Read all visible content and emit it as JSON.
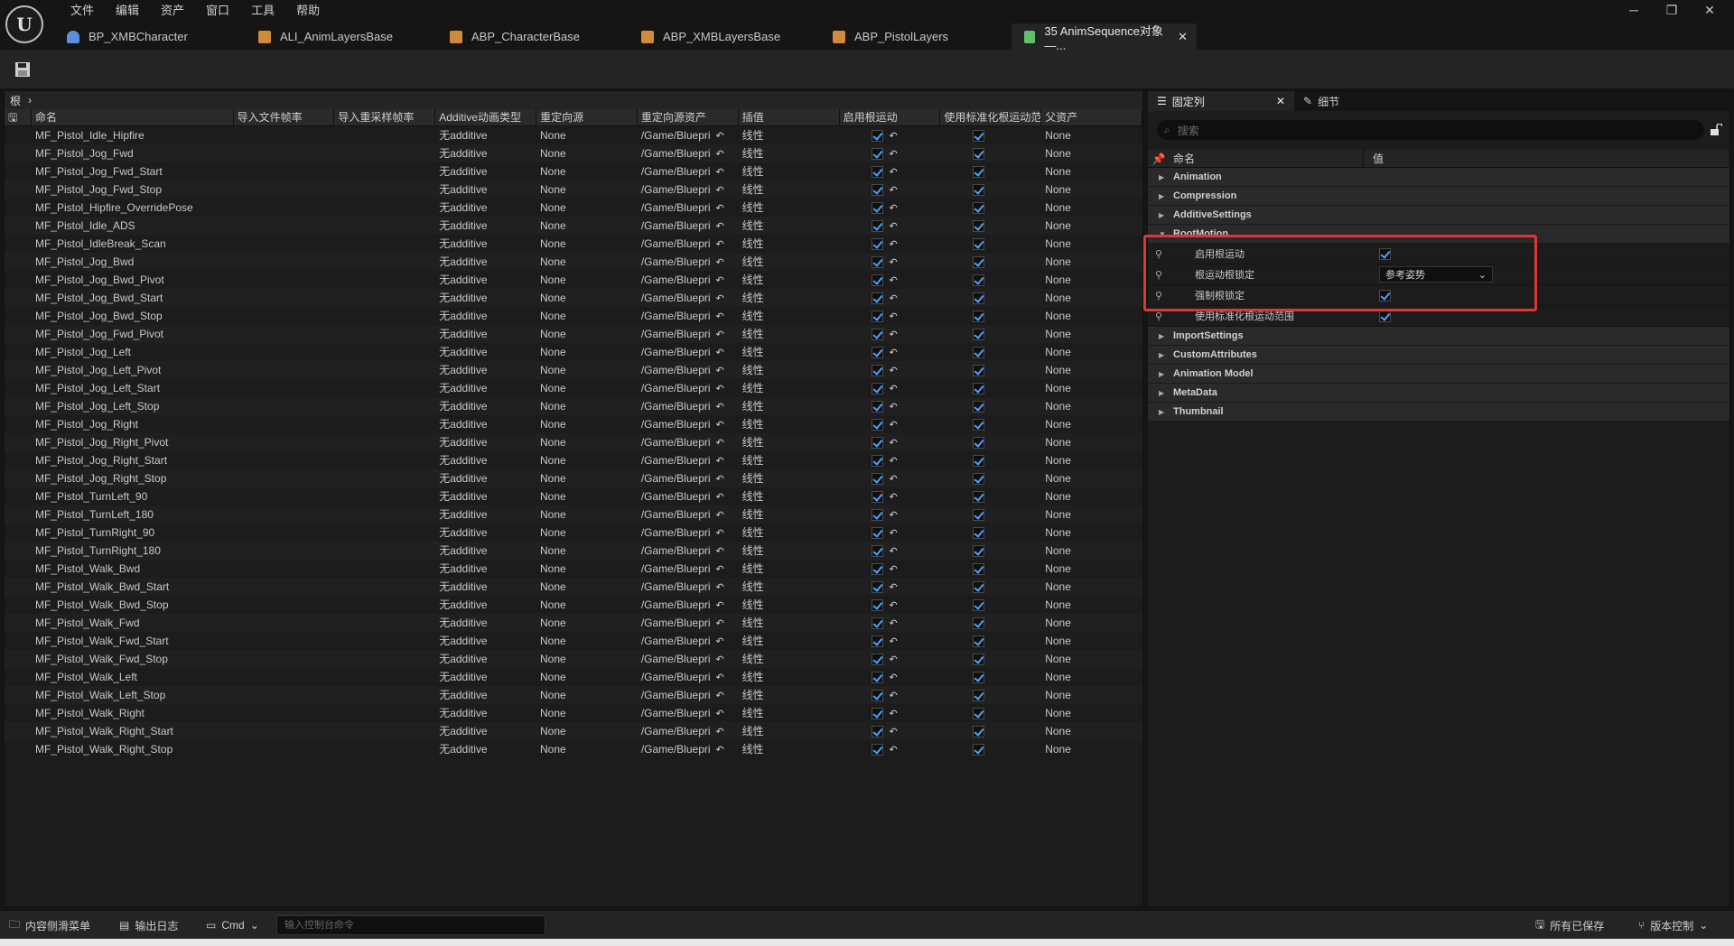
{
  "menu": [
    "文件",
    "编辑",
    "资产",
    "窗口",
    "工具",
    "帮助"
  ],
  "tabs": [
    {
      "label": "BP_XMBCharacter",
      "icon": "person-icon",
      "color": "#5b8fe0"
    },
    {
      "label": "ALI_AnimLayersBase",
      "icon": "anim-layer-icon",
      "color": "#d08b3a"
    },
    {
      "label": "ABP_CharacterBase",
      "icon": "anim-blueprint-icon",
      "color": "#d08b3a"
    },
    {
      "label": "ABP_XMBLayersBase",
      "icon": "anim-blueprint-icon",
      "color": "#d08b3a"
    },
    {
      "label": "ABP_PistolLayers",
      "icon": "anim-blueprint-icon",
      "color": "#d08b3a"
    },
    {
      "label": "35 AnimSequence对象—...",
      "icon": "anim-sequence-icon",
      "color": "#5fbf6a",
      "active": true
    }
  ],
  "breadcrumb": {
    "root": "根"
  },
  "grid": {
    "headers": [
      "命名",
      "导入文件帧率",
      "导入重采样帧率",
      "Additive动画类型",
      "重定向源",
      "重定向源资产",
      "插值",
      "启用根运动",
      "使用标准化根运动范",
      "父资产"
    ],
    "common": {
      "additive": "无additive",
      "retarget": "None",
      "asset": "/Game/Bluepri",
      "interp": "线性",
      "parent": "None"
    },
    "rows": [
      "MF_Pistol_Idle_Hipfire",
      "MF_Pistol_Jog_Fwd",
      "MF_Pistol_Jog_Fwd_Start",
      "MF_Pistol_Jog_Fwd_Stop",
      "MF_Pistol_Hipfire_OverridePose",
      "MF_Pistol_Idle_ADS",
      "MF_Pistol_IdleBreak_Scan",
      "MF_Pistol_Jog_Bwd",
      "MF_Pistol_Jog_Bwd_Pivot",
      "MF_Pistol_Jog_Bwd_Start",
      "MF_Pistol_Jog_Bwd_Stop",
      "MF_Pistol_Jog_Fwd_Pivot",
      "MF_Pistol_Jog_Left",
      "MF_Pistol_Jog_Left_Pivot",
      "MF_Pistol_Jog_Left_Start",
      "MF_Pistol_Jog_Left_Stop",
      "MF_Pistol_Jog_Right",
      "MF_Pistol_Jog_Right_Pivot",
      "MF_Pistol_Jog_Right_Start",
      "MF_Pistol_Jog_Right_Stop",
      "MF_Pistol_TurnLeft_90",
      "MF_Pistol_TurnLeft_180",
      "MF_Pistol_TurnRight_90",
      "MF_Pistol_TurnRight_180",
      "MF_Pistol_Walk_Bwd",
      "MF_Pistol_Walk_Bwd_Start",
      "MF_Pistol_Walk_Bwd_Stop",
      "MF_Pistol_Walk_Fwd",
      "MF_Pistol_Walk_Fwd_Start",
      "MF_Pistol_Walk_Fwd_Stop",
      "MF_Pistol_Walk_Left",
      "MF_Pistol_Walk_Left_Stop",
      "MF_Pistol_Walk_Right",
      "MF_Pistol_Walk_Right_Start",
      "MF_Pistol_Walk_Right_Stop"
    ]
  },
  "details": {
    "tab_pinned": "固定列",
    "tab_details": "细节",
    "search_placeholder": "搜索",
    "col_name": "命名",
    "col_value": "值",
    "categories_top": [
      "Animation",
      "Compression",
      "AdditiveSettings"
    ],
    "rootmotion": {
      "label": "RootMotion",
      "props": [
        {
          "name": "启用根运动",
          "type": "checkbox",
          "checked": true
        },
        {
          "name": "根运动根锁定",
          "type": "dropdown",
          "value": "参考姿势"
        },
        {
          "name": "强制根锁定",
          "type": "checkbox",
          "checked": true
        },
        {
          "name": "使用标准化根运动范围",
          "type": "checkbox",
          "checked": true
        }
      ]
    },
    "categories_bottom": [
      "ImportSettings",
      "CustomAttributes",
      "Animation Model",
      "MetaData",
      "Thumbnail"
    ]
  },
  "statusbar": {
    "content_drawer": "内容侧滑菜单",
    "output_log": "输出日志",
    "cmd": "Cmd",
    "console_placeholder": "输入控制台命令",
    "all_saved": "所有已保存",
    "source_control": "版本控制"
  },
  "colors": {
    "accent": "#4aa3ff",
    "highlight": "#e03535"
  }
}
